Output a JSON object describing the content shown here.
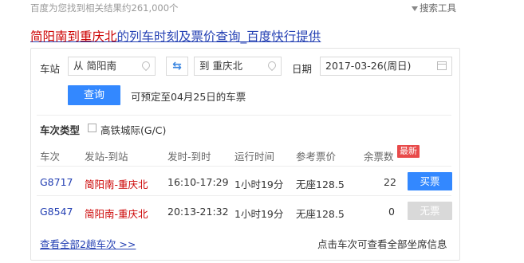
{
  "search": {
    "result_count": "百度为您找到相关结果约261,000个",
    "tools_label": "搜索工具"
  },
  "result": {
    "title_hl1": "简阳南",
    "title_mid1": "到",
    "title_hl2": "重庆北",
    "title_rest": "的列车时刻及票价查询_百度快行提供"
  },
  "form": {
    "station_label": "车站",
    "from_value": "从 简阳南",
    "to_value": "到 重庆北",
    "swap_icon": "⇆",
    "date_label": "日期",
    "date_value": "2017-03-26(周日)",
    "query_button": "查询",
    "advance_text": "可预定至04月25日的车票"
  },
  "filter": {
    "type_label": "车次类型",
    "option_label": "高铁城际(G/C)",
    "option_checked": false
  },
  "table": {
    "headers": [
      "车次",
      "发站-到站",
      "发时-到时",
      "运行时间",
      "参考票价",
      "余票数"
    ],
    "new_badge": "最新",
    "rows": [
      {
        "train": "G8717",
        "route": "简阳南-重庆北",
        "times": "16:10-17:29",
        "duration": "1小时19分",
        "price": "无座128.5",
        "remaining": "22",
        "action": "买票",
        "action_enabled": true
      },
      {
        "train": "G8547",
        "route": "简阳南-重庆北",
        "times": "20:13-21:32",
        "duration": "1小时19分",
        "price": "无座128.5",
        "remaining": "0",
        "action": "无票",
        "action_enabled": false
      }
    ]
  },
  "footer": {
    "view_all": "查看全部2趟车次 >>",
    "hint": "点击车次可查看全部坐席信息"
  },
  "colors": {
    "link": "#2440b3",
    "highlight": "#cc0000",
    "primary_button": "#3388ff",
    "badge": "#e84a4a"
  }
}
